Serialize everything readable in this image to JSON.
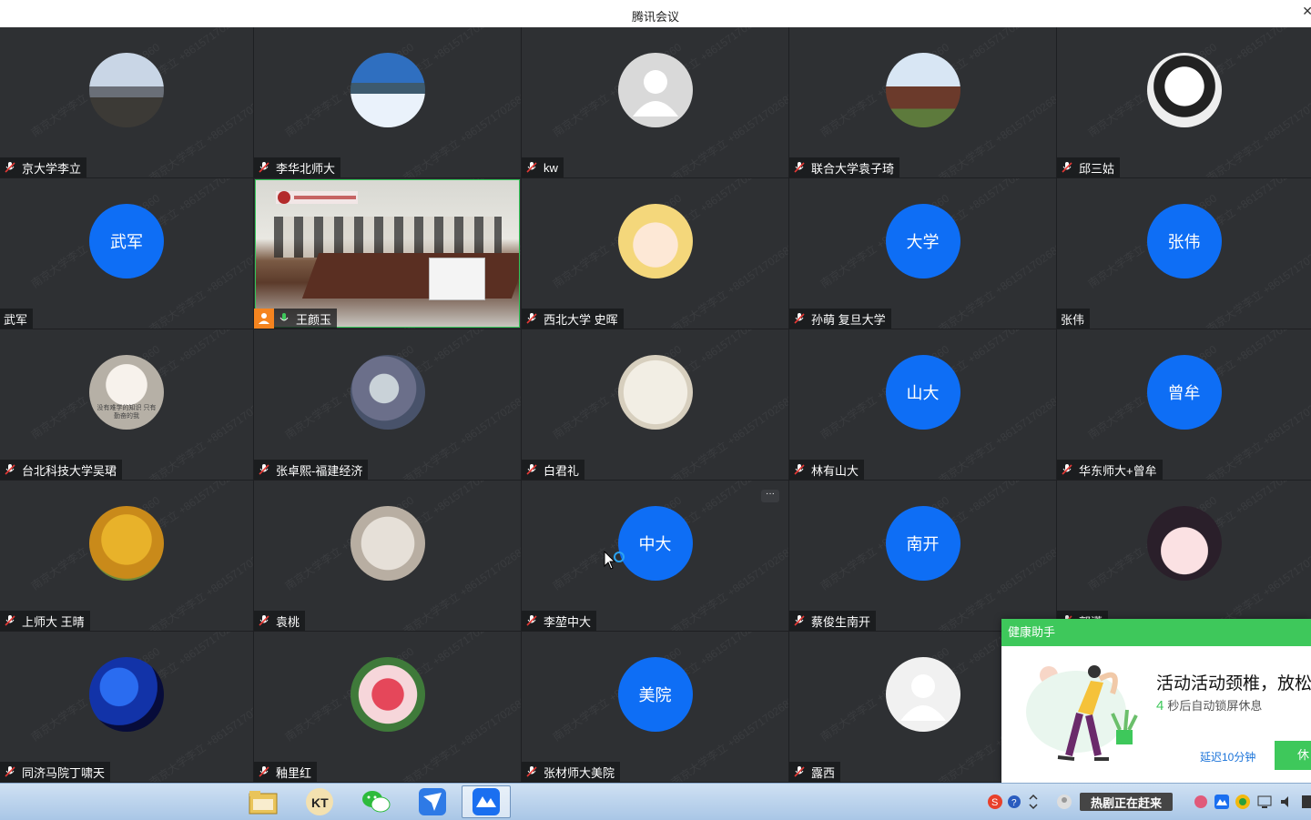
{
  "window": {
    "title": "腾讯会议"
  },
  "participants": [
    {
      "name": "京大学李立",
      "avatar_text": null,
      "avatar_kind": "photo-city"
    },
    {
      "name": "李华北师大",
      "avatar_text": null,
      "avatar_kind": "photo-mountain"
    },
    {
      "name": "kw",
      "avatar_text": null,
      "avatar_kind": "default-person"
    },
    {
      "name": "联合大学袁子琦",
      "avatar_text": null,
      "avatar_kind": "photo-palace"
    },
    {
      "name": "邱三姑",
      "avatar_text": null,
      "avatar_kind": "photo-dog"
    },
    {
      "name": "武军",
      "avatar_text": "武军",
      "avatar_kind": "text"
    },
    {
      "name": "王颜玉",
      "avatar_text": null,
      "avatar_kind": "video"
    },
    {
      "name": "西北大学 史晖",
      "avatar_text": null,
      "avatar_kind": "cartoon"
    },
    {
      "name": "孙萌 复旦大学",
      "avatar_text": "大学",
      "avatar_kind": "text"
    },
    {
      "name": "张伟",
      "avatar_text": "张伟",
      "avatar_kind": "text"
    },
    {
      "name": "台北科技大学吴珺",
      "avatar_text": null,
      "avatar_kind": "photo-puppy",
      "avatar_caption": "没有难学的知识 只有勤奋的我"
    },
    {
      "name": "张卓熙-福建经济",
      "avatar_text": null,
      "avatar_kind": "drawing"
    },
    {
      "name": "白君礼",
      "avatar_text": null,
      "avatar_kind": "painting"
    },
    {
      "name": "林有山大",
      "avatar_text": "山大",
      "avatar_kind": "text"
    },
    {
      "name": "华东师大+曾牟",
      "avatar_text": "曾牟",
      "avatar_kind": "text"
    },
    {
      "name": "上师大 王晴",
      "avatar_text": null,
      "avatar_kind": "photo-tree"
    },
    {
      "name": "袁桃",
      "avatar_text": null,
      "avatar_kind": "sketch"
    },
    {
      "name": "李堃中大",
      "avatar_text": "中大",
      "avatar_kind": "text"
    },
    {
      "name": "蔡俊生南开",
      "avatar_text": "南开",
      "avatar_kind": "text"
    },
    {
      "name": "郭潇",
      "avatar_text": null,
      "avatar_kind": "anime-girl"
    },
    {
      "name": "同济马院丁啸天",
      "avatar_text": null,
      "avatar_kind": "photo-blue"
    },
    {
      "name": "釉里红",
      "avatar_text": null,
      "avatar_kind": "photo-flower"
    },
    {
      "name": "张材师大美院",
      "avatar_text": "美院",
      "avatar_kind": "text"
    },
    {
      "name": "露西",
      "avatar_text": null,
      "avatar_kind": "default-person-light"
    }
  ],
  "more_button": "···",
  "watermark": "南京大学李立 +8615717026860",
  "health_popup": {
    "header": "健康助手",
    "headline": "活动活动颈椎，放松",
    "countdown": "4",
    "countdown_suffix": "秒后自动锁屏休息",
    "delay_button": "延迟10分钟",
    "rest_button": "休"
  },
  "taskbar": {
    "apps": [
      "file-explorer-icon",
      "kt-icon",
      "wechat-icon",
      "feishu-bird-icon",
      "tencent-meeting-icon"
    ],
    "tray_banner": "热剧正在赶来"
  },
  "colors": {
    "tile_bg": "#2e3033",
    "avatar_blue": "#0e6ef5",
    "green": "#3ec85b",
    "speaker_orange": "#f5841f"
  }
}
